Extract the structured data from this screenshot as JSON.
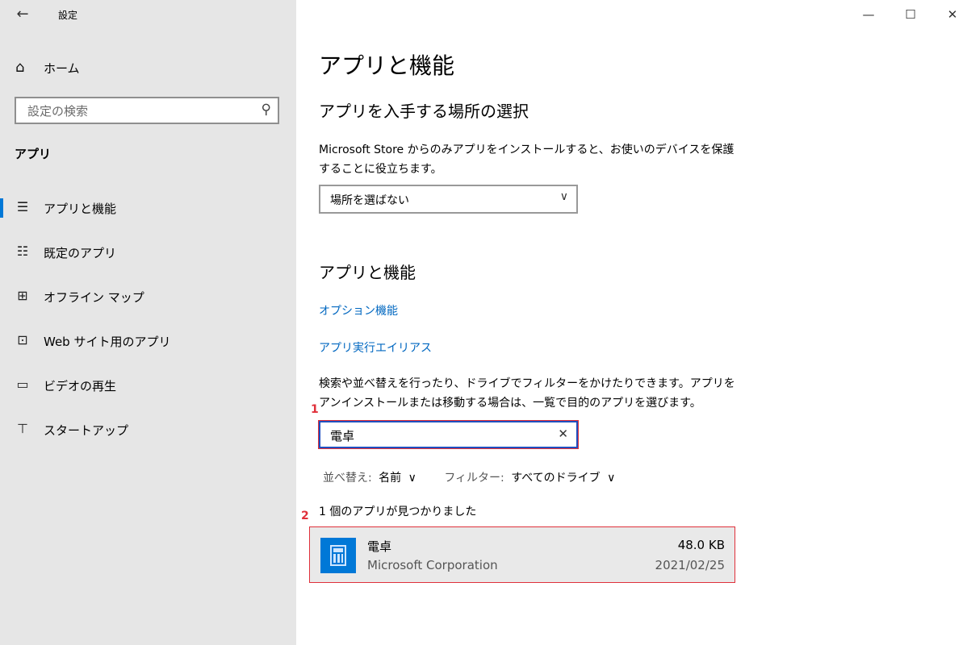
{
  "window": {
    "title": "設定",
    "controls": {
      "minimize": "—",
      "maximize": "☐",
      "close": "✕"
    }
  },
  "sidebar": {
    "back_icon": "←",
    "home": {
      "icon": "⌂",
      "label": "ホーム"
    },
    "search": {
      "placeholder": "設定の検索",
      "icon": "⚲"
    },
    "section_title": "アプリ",
    "items": [
      {
        "icon": "☰",
        "label": "アプリと機能",
        "active": true
      },
      {
        "icon": "☷",
        "label": "既定のアプリ",
        "active": false
      },
      {
        "icon": "⊞",
        "label": "オフライン マップ",
        "active": false
      },
      {
        "icon": "⊡",
        "label": "Web サイト用のアプリ",
        "active": false
      },
      {
        "icon": "▭",
        "label": "ビデオの再生",
        "active": false
      },
      {
        "icon": "⊤",
        "label": "スタートアップ",
        "active": false
      }
    ]
  },
  "main": {
    "page_title": "アプリと機能",
    "source_section": {
      "heading": "アプリを入手する場所の選択",
      "description": "Microsoft Store からのみアプリをインストールすると、お使いのデバイスを保護することに役立ちます。",
      "dropdown_value": "場所を選ばない",
      "dropdown_icon": "∨"
    },
    "apps_section": {
      "heading": "アプリと機能",
      "link_optional": "オプション機能",
      "link_alias": "アプリ実行エイリアス",
      "description": "検索や並べ替えを行ったり、ドライブでフィルターをかけたりできます。アプリをアンインストールまたは移動する場合は、一覧で目的のアプリを選びます。",
      "search_value": "電卓",
      "clear_icon": "✕",
      "sort_label": "並べ替え:",
      "sort_value": "名前",
      "filter_label": "フィルター:",
      "filter_value": "すべてのドライブ",
      "chevron": "∨",
      "result_count": "1 個のアプリが見つかりました"
    },
    "markers": {
      "one": "1",
      "two": "2"
    },
    "app": {
      "name": "電卓",
      "publisher": "Microsoft Corporation",
      "size": "48.0 KB",
      "date": "2021/02/25",
      "icon": "calculator-icon"
    }
  },
  "colors": {
    "sidebar_bg": "#e6e6e6",
    "accent": "#0078d7",
    "link": "#0067c0",
    "highlight_marker": "#e0303a"
  }
}
